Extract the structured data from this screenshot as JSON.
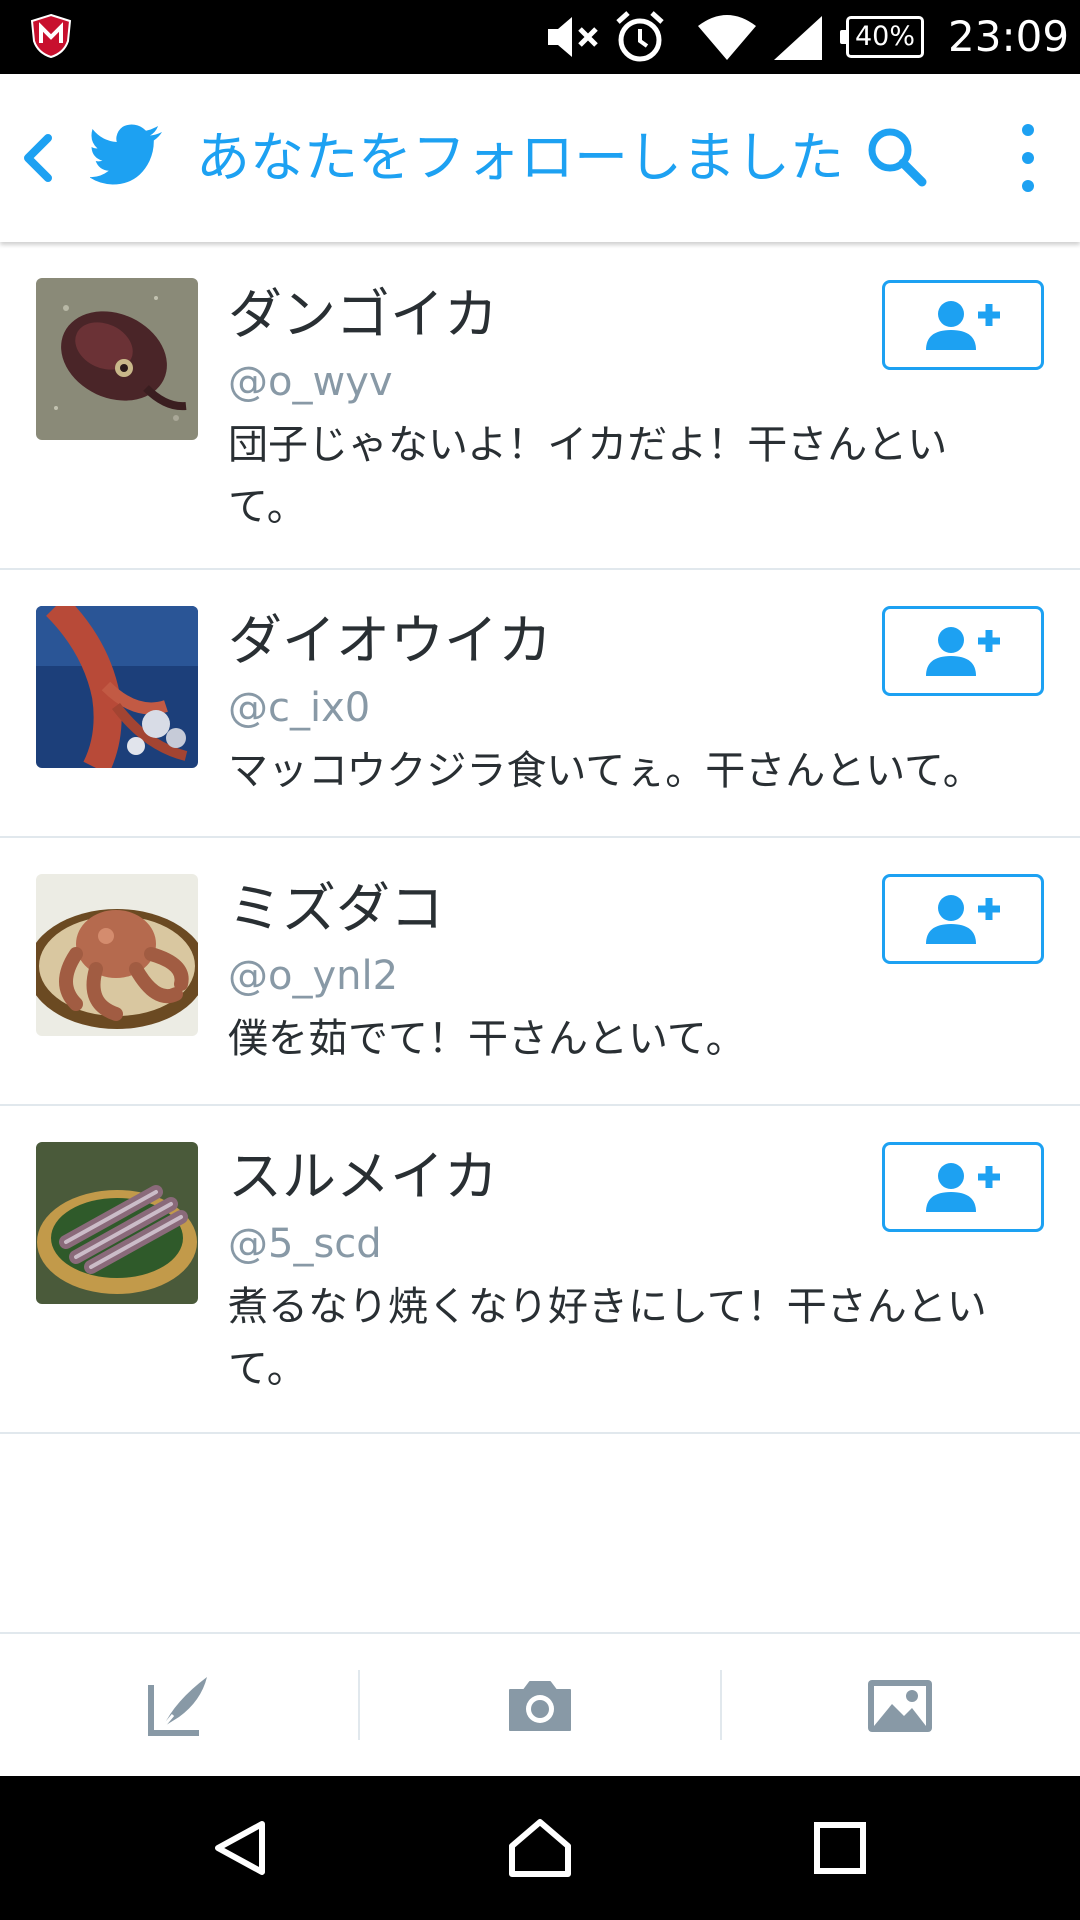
{
  "status_bar": {
    "battery": "40%",
    "time": "23:09"
  },
  "header": {
    "title": "あなたをフォローしました"
  },
  "users": [
    {
      "name": "ダンゴイカ",
      "handle": "@o_wyv",
      "bio": "団子じゃないよ！イカだよ！干さんといて。"
    },
    {
      "name": "ダイオウイカ",
      "handle": "@c_ix0",
      "bio": "マッコウクジラ食いてぇ。干さんといて。"
    },
    {
      "name": "ミズダコ",
      "handle": "@o_ynl2",
      "bio": "僕を茹でて！干さんといて。"
    },
    {
      "name": "スルメイカ",
      "handle": "@5_scd",
      "bio": "煮るなり焼くなり好きにして！干さんといて。"
    }
  ],
  "icons": {
    "back": "chevron-left-icon",
    "logo": "twitter-bird-icon",
    "search": "search-icon",
    "more": "more-vertical-icon",
    "follow": "add-user-icon",
    "compose": "compose-icon",
    "camera": "camera-icon",
    "gallery": "image-icon",
    "nav_back": "nav-back-icon",
    "nav_home": "nav-home-icon",
    "nav_recents": "nav-recents-icon"
  },
  "colors": {
    "accent": "#1da1f2",
    "text": "#292f33",
    "secondary_text": "#8899a6",
    "divider": "#e1e8ed",
    "toolbar_icon": "#8899a6"
  }
}
